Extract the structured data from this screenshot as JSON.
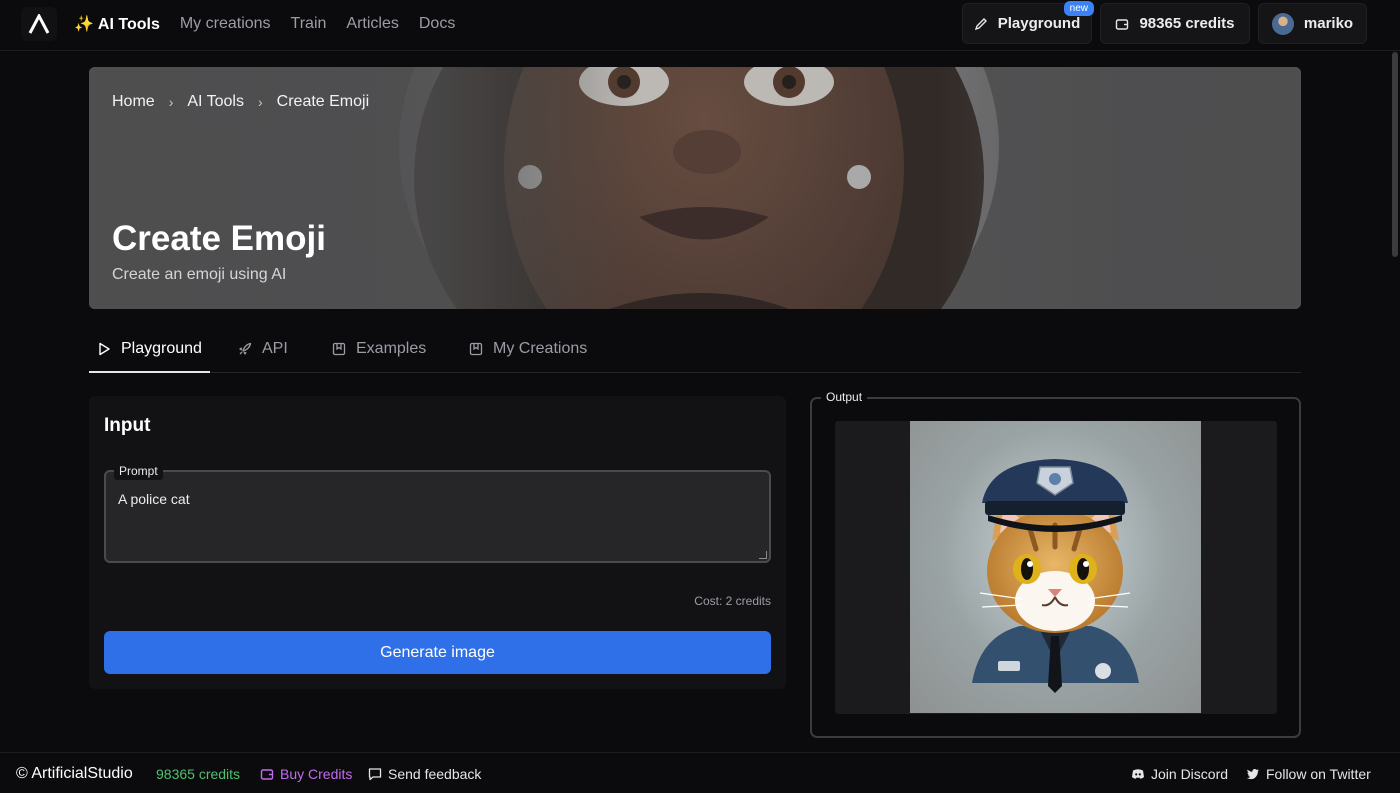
{
  "topbar": {
    "nav": {
      "ai_tools": "AI Tools",
      "ai_tools_sparkle": "✨",
      "my_creations": "My creations",
      "train": "Train",
      "articles": "Articles",
      "docs": "Docs"
    },
    "playground": {
      "label": "Playground",
      "badge": "new",
      "icon": "pencil-icon"
    },
    "credits": {
      "label": "98365 credits",
      "icon": "wallet-icon"
    },
    "user": {
      "name": "mariko"
    }
  },
  "hero": {
    "breadcrumb": [
      "Home",
      "AI Tools",
      "Create Emoji"
    ],
    "title": "Create Emoji",
    "subtitle": "Create an emoji using AI"
  },
  "tabs": [
    {
      "label": "Playground",
      "icon": "play-icon",
      "active": true
    },
    {
      "label": "API",
      "icon": "rocket-icon",
      "active": false
    },
    {
      "label": "Examples",
      "icon": "bookmark-icon",
      "active": false
    },
    {
      "label": "My Creations",
      "icon": "bookmark-icon",
      "active": false
    }
  ],
  "input": {
    "title": "Input",
    "prompt_label": "Prompt",
    "prompt_value": "A police cat",
    "cost": "Cost: 2 credits",
    "generate_label": "Generate image"
  },
  "output": {
    "label": "Output"
  },
  "footer": {
    "brand": "© ArtificialStudio",
    "credits": "98365 credits",
    "buy": "Buy Credits",
    "feedback": "Send feedback",
    "discord": "Join Discord",
    "twitter": "Follow on Twitter"
  },
  "colors": {
    "accent_blue": "#2f6fe8",
    "credits_green": "#4fc16f",
    "buy_purple": "#c36bf0",
    "badge_blue": "#3b82f6"
  }
}
